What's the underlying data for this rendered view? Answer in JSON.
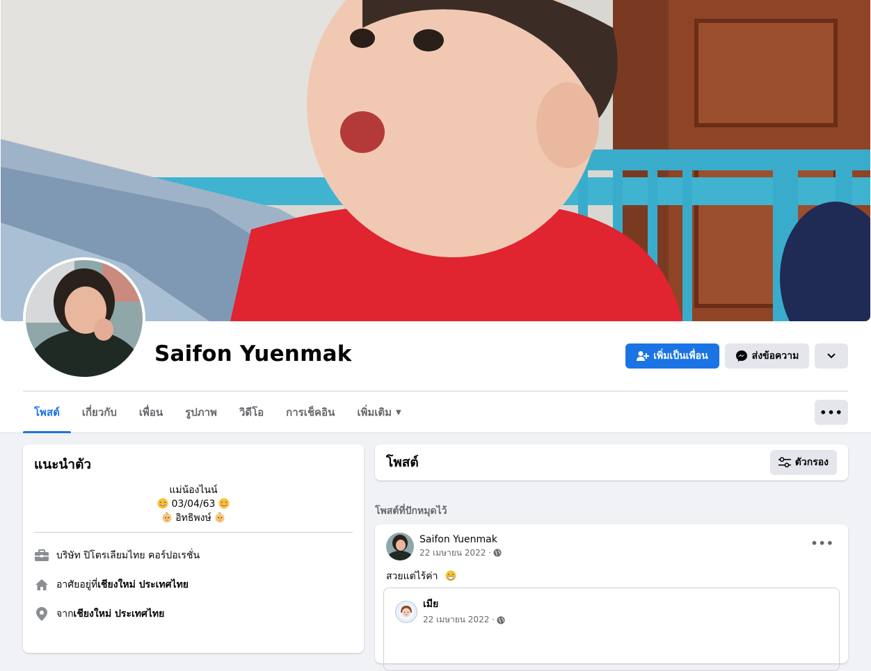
{
  "profile": {
    "name": "Saifon Yuenmak",
    "add_friend_label": "เพิ่มเป็นเพื่อน",
    "message_label": "ส่งข้อความ"
  },
  "tabs": [
    {
      "label": "โพสต์",
      "active": true
    },
    {
      "label": "เกี่ยวกับ"
    },
    {
      "label": "เพื่อน"
    },
    {
      "label": "รูปภาพ"
    },
    {
      "label": "วิดีโอ"
    },
    {
      "label": "การเช็คอิน"
    },
    {
      "label": "เพิ่มเติม"
    }
  ],
  "intro": {
    "title": "แนะนำตัว",
    "bio_line1": "แม่น้องไนน์",
    "bio_line2": "03/04/63",
    "bio_line3": "อิทธิพงษ์",
    "work": "บริษัท ปิโตรเลียมไทย คอร์ปอเรชั่น",
    "lives_prefix": "อาศัยอยู่ที่ ",
    "lives_place": "เชียงใหม่ ประเทศไทย",
    "from_prefix": "จาก ",
    "from_place": "เชียงใหม่ ประเทศไทย",
    "icons": [
      "briefcase-icon",
      "home-icon",
      "location-pin-icon"
    ]
  },
  "posts": {
    "title": "โพสต์",
    "filter_label": "ตัวกรอง",
    "pinned_label": "โพสต์ที่ปักหมุดไว้"
  },
  "post": {
    "author": "Saifon Yuenmak",
    "date": "22 เมษายน 2022 ·",
    "text": "สวยแต่ไร้ค่า",
    "shared_author": "เมีย",
    "shared_date": "22 เมษายน 2022 ·"
  },
  "colors": {
    "accent": "#1b74e4",
    "background": "#f0f2f5",
    "button_gray": "#e4e6eb",
    "secondary_text": "#65676b"
  }
}
